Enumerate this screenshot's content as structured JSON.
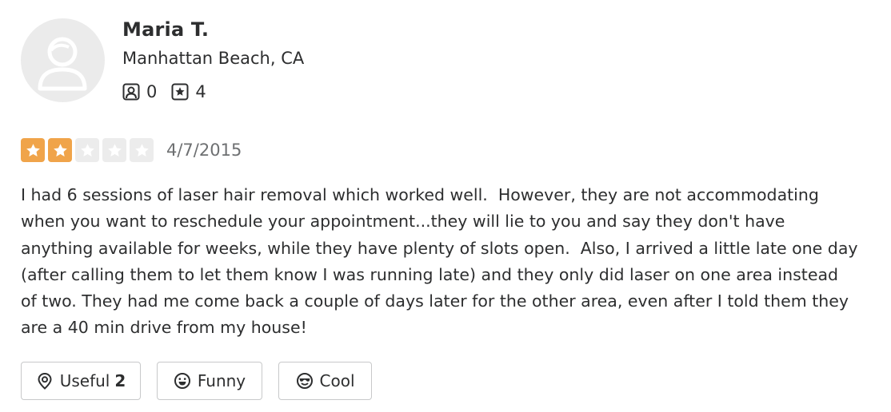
{
  "reviewer": {
    "name": "Maria T.",
    "location": "Manhattan Beach, CA",
    "friends_count": "0",
    "reviews_count": "4"
  },
  "review": {
    "rating": 2,
    "max_rating": 5,
    "date": "4/7/2015",
    "text": "I had 6 sessions of laser hair removal which worked well.  However, they are not accommodating\nwhen you want to reschedule your appointment...they will lie to you and say they don't have\nanything available for weeks, while they have plenty of slots open.  Also, I arrived a little late one day\n(after calling them to let them know I was running late) and they only did laser on one area instead\nof two. They had me come back a couple of days later for the other area, even after I told them they\nare a 40 min drive from my house!"
  },
  "actions": {
    "useful_label": "Useful",
    "useful_count": "2",
    "funny_label": "Funny",
    "cool_label": "Cool"
  },
  "colors": {
    "star_filled": "#f0a44a",
    "star_empty": "#ececec",
    "text": "#2d2e2f",
    "date": "#6e7072",
    "border": "#c8c9ca",
    "avatar_bg": "#ebebeb"
  },
  "icons": {
    "friends": "friends-icon",
    "reviews": "reviews-icon",
    "useful": "useful-icon",
    "funny": "funny-icon",
    "cool": "cool-icon"
  }
}
